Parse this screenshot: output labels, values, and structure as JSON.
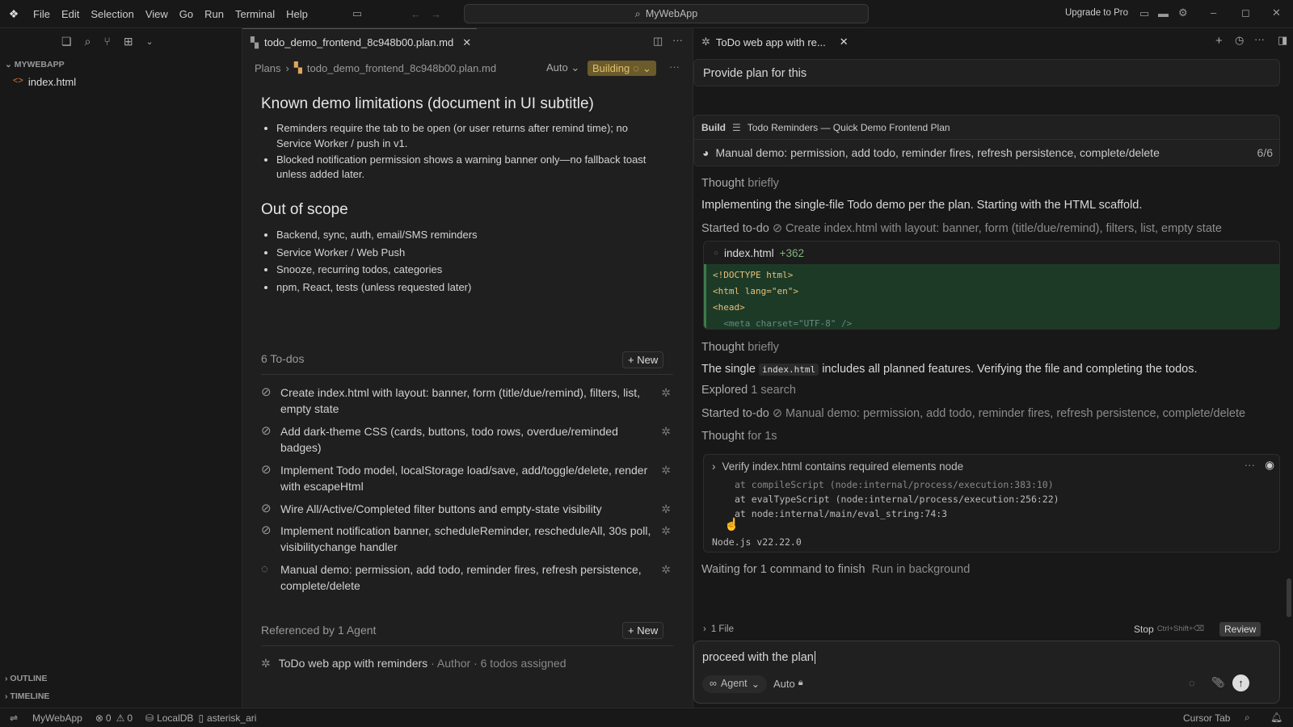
{
  "titlebar": {
    "menu": [
      "File",
      "Edit",
      "Selection",
      "View",
      "Go",
      "Run",
      "Terminal",
      "Help"
    ],
    "search_label": "MyWebApp",
    "upgrade_label": "Upgrade to Pro"
  },
  "sidebar": {
    "section_title": "MYWEBAPP",
    "file": "index.html",
    "outline": "OUTLINE",
    "timeline": "TIMELINE"
  },
  "editor": {
    "tab_label": "todo_demo_frontend_8c948b00.plan.md",
    "breadcrumb_root": "Plans",
    "breadcrumb_file": "todo_demo_frontend_8c948b00.plan.md",
    "mode_label": "Auto",
    "building_label": "Building",
    "heading1": "Known demo limitations (document in UI subtitle)",
    "limitations": [
      "Reminders require the tab to be open (or user returns after remind time); no Service Worker / push in v1.",
      "Blocked notification permission shows a warning banner only—no fallback toast unless added later."
    ],
    "heading2": "Out of scope",
    "out_of_scope": [
      "Backend, sync, auth, email/SMS reminders",
      "Service Worker / Web Push",
      "Snooze, recurring todos, categories",
      "npm, React, tests (unless requested later)"
    ],
    "todos_title": "6 To-dos",
    "new_label": "+ New",
    "todos": [
      "Create index.html with layout: banner, form (title/due/remind), filters, list, empty state",
      "Add dark-theme CSS (cards, buttons, todo rows, overdue/reminded badges)",
      "Implement Todo model, localStorage load/save, add/toggle/delete, render with escapeHtml",
      "Wire All/Active/Completed filter buttons and empty-state visibility",
      "Implement notification banner, scheduleReminder, rescheduleAll, 30s poll, visibilitychange handler",
      "Manual demo: permission, add todo, reminder fires, refresh persistence, complete/delete"
    ],
    "referenced_title": "Referenced by 1 Agent",
    "agent_name": "ToDo web app with reminders",
    "agent_meta": "· Author · 6 todos assigned"
  },
  "chat": {
    "tab_label": "ToDo web app with re...",
    "prompt": "Provide plan for this",
    "build_label": "Build",
    "plan_title": "Todo Reminders — Quick Demo Frontend Plan",
    "progress_text": "Manual demo: permission, add todo, reminder fires, refresh persistence, complete/delete",
    "progress_count": "6/6",
    "thought1_a": "Thought",
    "thought1_b": "briefly",
    "msg1": "Implementing the single-file Todo demo per the plan. Starting with the HTML scaffold.",
    "started1_a": "Started to-do",
    "started1_b": "Create index.html with layout: banner, form (title/due/remind), filters, list, empty state",
    "file_name": "index.html",
    "file_diff": "+362",
    "code_lines": [
      "<!DOCTYPE html>",
      "<html lang=\"en\">",
      "<head>",
      "  <meta charset=\"UTF-8\" />"
    ],
    "thought2_a": "Thought",
    "thought2_b": "briefly",
    "msg2_a": "The single",
    "msg2_code": "index.html",
    "msg2_b": "includes all planned features. Verifying the file and completing the todos.",
    "explored_a": "Explored",
    "explored_b": "1 search",
    "started2_a": "Started to-do",
    "started2_b": "Manual demo: permission, add todo, reminder fires, refresh persistence, complete/delete",
    "thought3_a": "Thought",
    "thought3_b": "for 1s",
    "terminal_title": "Verify index.html contains required elements node",
    "terminal_lines": [
      "at compileScript (node:internal/process/execution:383:10)",
      "at evalTypeScript (node:internal/process/execution:256:22)",
      "at node:internal/main/eval_string:74:3"
    ],
    "node_version": "Node.js v22.22.0",
    "waiting": "Waiting for 1 command to finish",
    "run_bg": "Run in background",
    "files_label": "1 File",
    "stop_label": "Stop",
    "stop_shortcut": "Ctrl+Shift+⌫",
    "review_label": "Review",
    "input_value": "proceed with the plan",
    "agent_label": "Agent",
    "auto_label": "Auto"
  },
  "statusbar": {
    "project": "MyWebApp",
    "errors": "0",
    "warnings": "0",
    "db": "LocalDB",
    "branch": "asterisk_ari",
    "cursor_tab": "Cursor Tab"
  }
}
